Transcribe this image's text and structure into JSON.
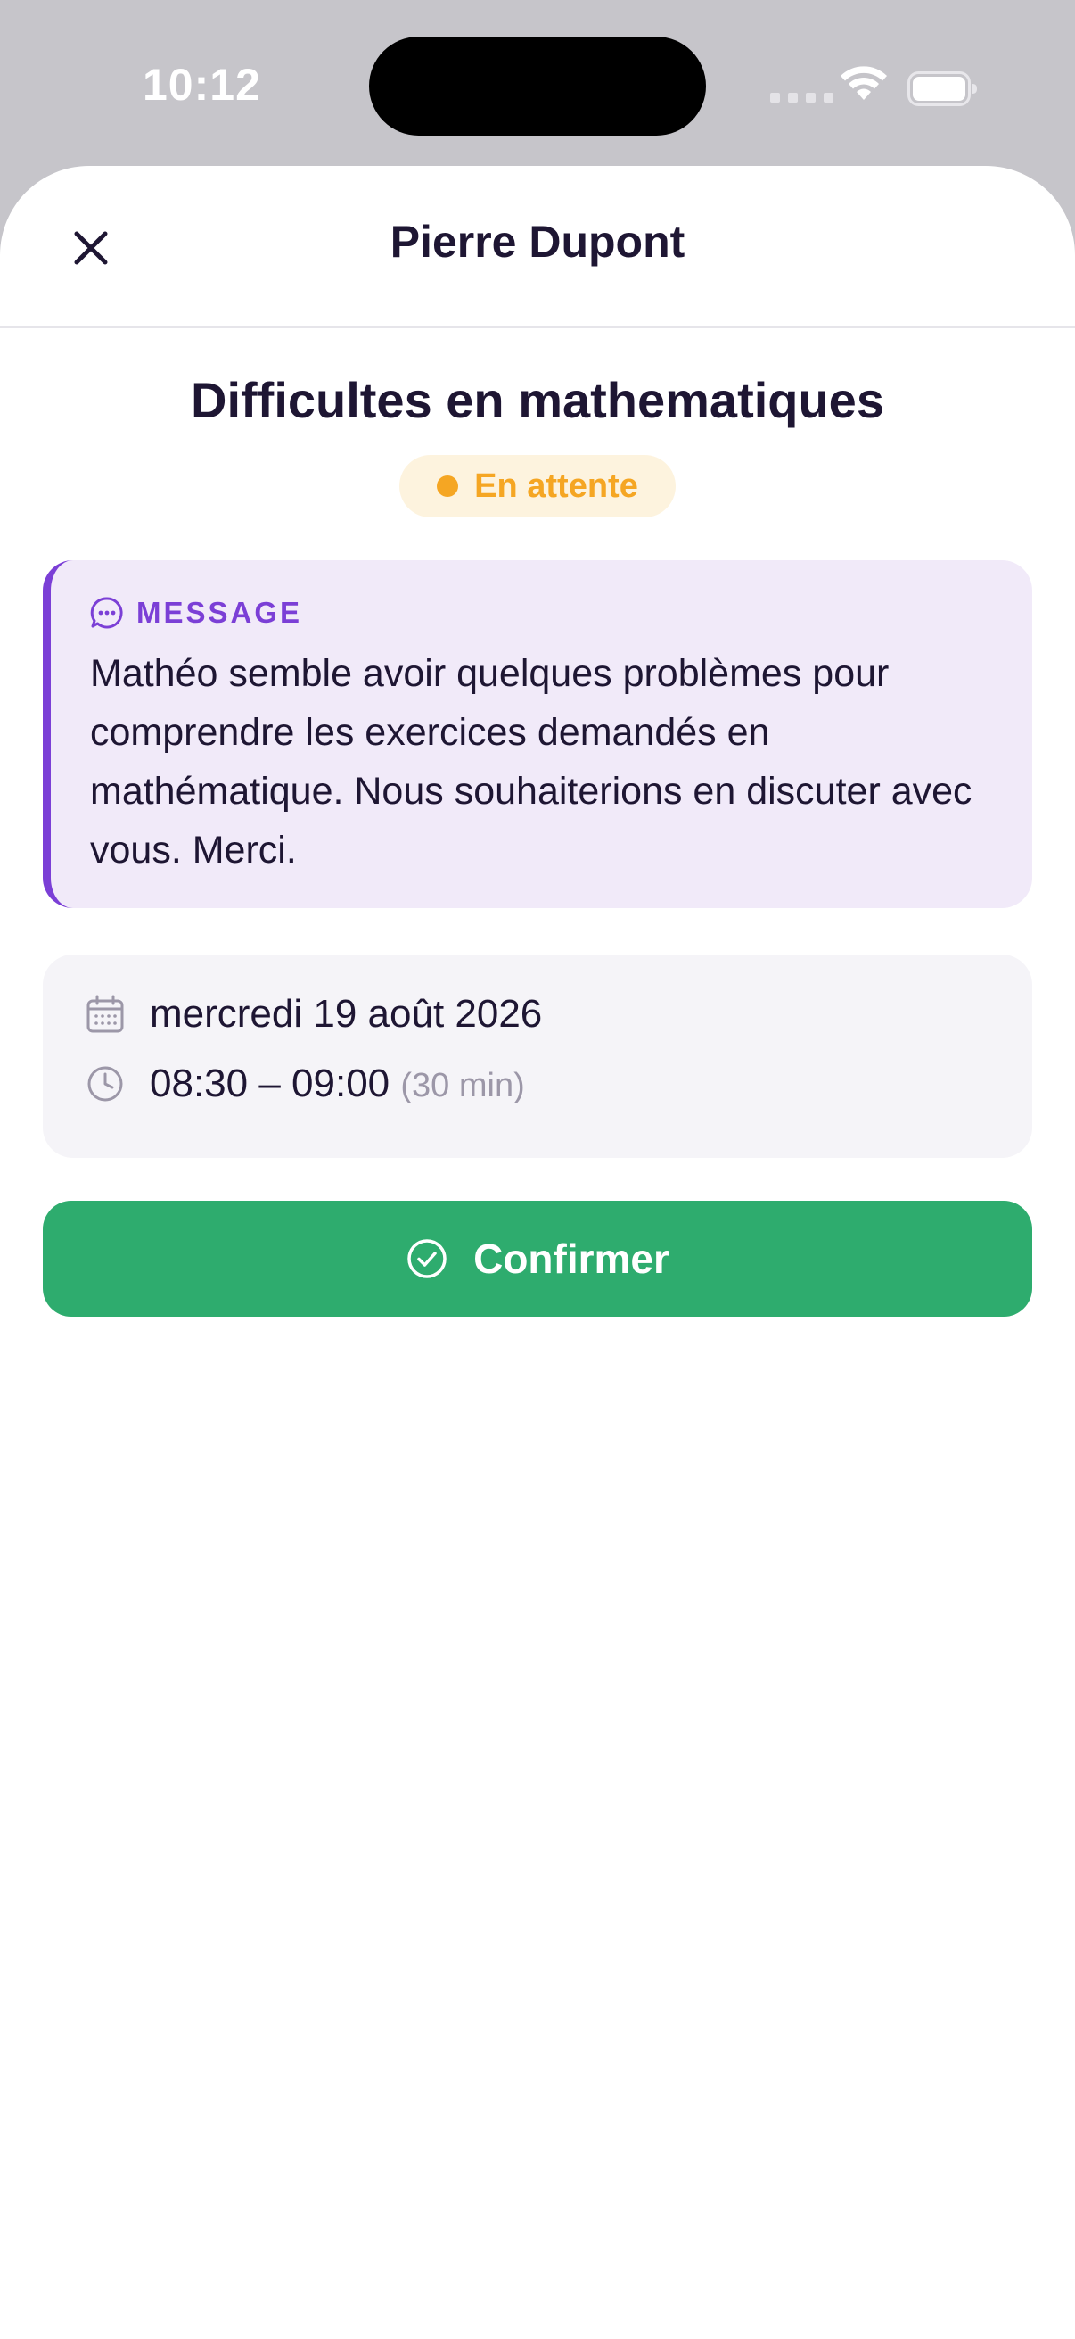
{
  "status_bar": {
    "time": "10:12",
    "icons": [
      "signal-icon",
      "wifi-icon",
      "battery-icon"
    ]
  },
  "sheet": {
    "title": "Pierre Dupont",
    "close_icon": "close-icon"
  },
  "appointment": {
    "subject": "Difficultes en mathematiques",
    "status": {
      "label": "En attente",
      "color": "#f5a623",
      "background": "#fdf3de"
    }
  },
  "message": {
    "icon": "chat-bubble-icon",
    "label": "MESSAGE",
    "body": "Mathéo semble avoir quelques problèmes pour comprendre les exercices demandés en mathématique. Nous souhaiterions en discuter avec vous. Merci.",
    "accent_color": "#7b3fd6",
    "background": "#f1eaf9"
  },
  "schedule": {
    "date_icon": "calendar-icon",
    "date": "mercredi 19 août 2026",
    "time_icon": "clock-icon",
    "time_range": "08:30 – 09:00",
    "duration": "(30 min)"
  },
  "actions": {
    "confirm_icon": "check-circle-icon",
    "confirm_label": "Confirmer",
    "confirm_color": "#2eac6e"
  }
}
